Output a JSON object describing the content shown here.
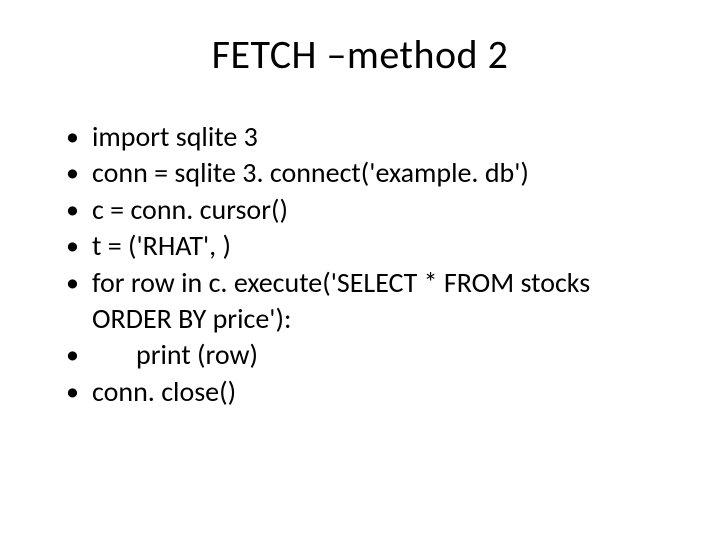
{
  "slide": {
    "title": "FETCH –method 2",
    "bullets": [
      {
        "text": "import sqlite 3",
        "indent": false
      },
      {
        "text": "conn = sqlite 3. connect('example. db')",
        "indent": false
      },
      {
        "text": "c = conn. cursor()",
        "indent": false
      },
      {
        "text": "t = ('RHAT', )",
        "indent": false
      },
      {
        "text": "for row in c. execute('SELECT * FROM stocks ORDER BY price'):",
        "indent": false
      },
      {
        "text": "print (row)",
        "indent": true
      },
      {
        "text": "conn. close()",
        "indent": false
      }
    ]
  }
}
